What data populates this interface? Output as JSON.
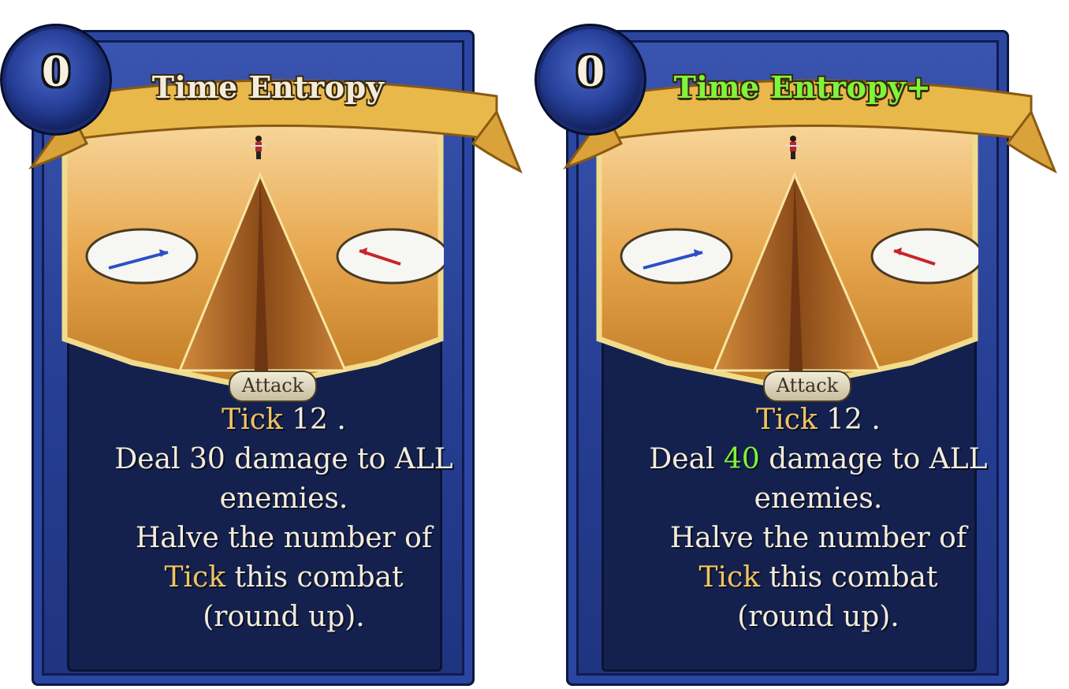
{
  "cards": [
    {
      "cost": "0",
      "title": "Time Entropy",
      "type": "Attack",
      "desc": {
        "line1_kw": "Tick",
        "line1_rest": " 12 .",
        "line2_a": "Deal ",
        "line2_num": "30",
        "line2_b": " damage to ALL",
        "line3": "enemies.",
        "line4": "Halve the number of",
        "line5_kw": "Tick",
        "line5_rest": " this combat",
        "line6": "(round up)."
      }
    },
    {
      "cost": "0",
      "title": "Time Entropy+",
      "type": "Attack",
      "desc": {
        "line1_kw": "Tick",
        "line1_rest": " 12 .",
        "line2_a": "Deal ",
        "line2_num": "40",
        "line2_b": " damage to ALL",
        "line3": "enemies.",
        "line4": "Halve the number of",
        "line5_kw": "Tick",
        "line5_rest": " this combat",
        "line6": "(round up)."
      }
    }
  ],
  "colors": {
    "frame_blue": "#263e93",
    "panel_navy": "#14214f",
    "banner_gold": "#e9b84a",
    "keyword_gold": "#f0c45e",
    "upgrade_green": "#7ef53a",
    "text_cream": "#f3ecd8",
    "blue_needle": "#2c4fc8",
    "red_needle": "#c8242a"
  }
}
